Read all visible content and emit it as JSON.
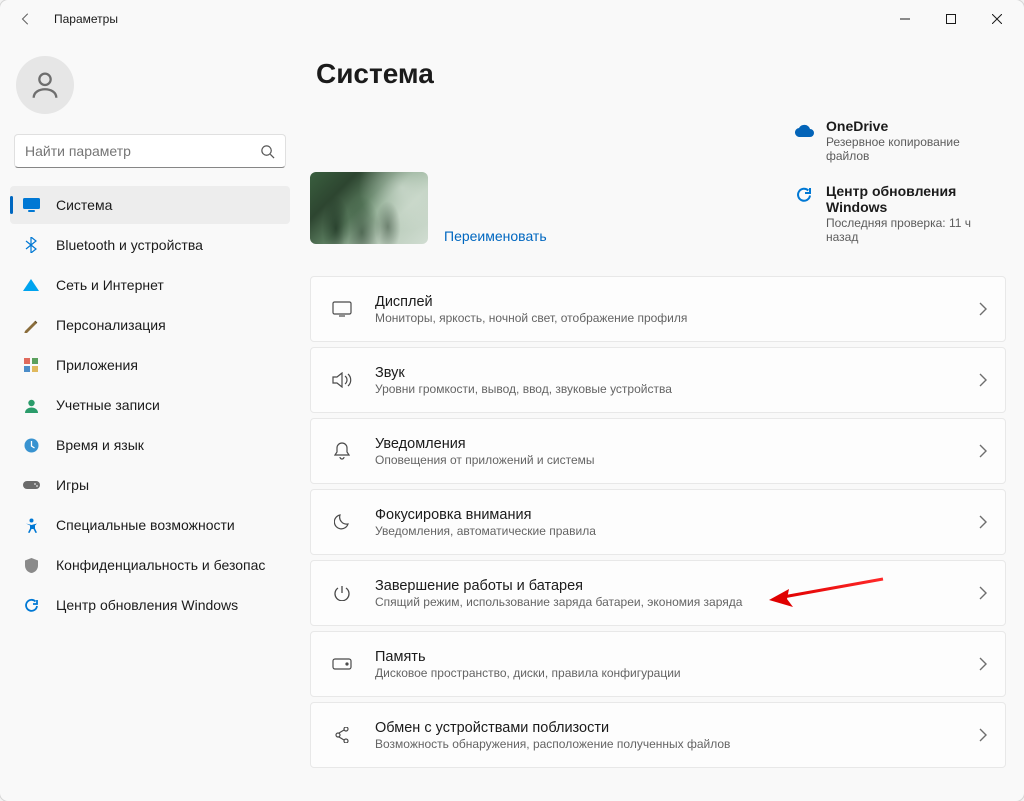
{
  "window": {
    "title": "Параметры"
  },
  "search": {
    "placeholder": "Найти параметр"
  },
  "sidebar": {
    "items": [
      {
        "id": "system",
        "label": "Система"
      },
      {
        "id": "bluetooth",
        "label": "Bluetooth и устройства"
      },
      {
        "id": "network",
        "label": "Сеть и Интернет"
      },
      {
        "id": "personalization",
        "label": "Персонализация"
      },
      {
        "id": "apps",
        "label": "Приложения"
      },
      {
        "id": "accounts",
        "label": "Учетные записи"
      },
      {
        "id": "time",
        "label": "Время и язык"
      },
      {
        "id": "gaming",
        "label": "Игры"
      },
      {
        "id": "accessibility",
        "label": "Специальные возможности"
      },
      {
        "id": "privacy",
        "label": "Конфиденциальность и безопас"
      },
      {
        "id": "update",
        "label": "Центр обновления Windows"
      }
    ]
  },
  "page": {
    "title": "Система",
    "rename": "Переименовать"
  },
  "onedrive": {
    "title": "OneDrive",
    "sub": "Резервное копирование файлов"
  },
  "update": {
    "title": "Центр обновления Windows",
    "sub": "Последняя проверка: 11 ч назад"
  },
  "rows": [
    {
      "title": "Дисплей",
      "sub": "Мониторы, яркость, ночной свет, отображение профиля"
    },
    {
      "title": "Звук",
      "sub": "Уровни громкости, вывод, ввод, звуковые устройства"
    },
    {
      "title": "Уведомления",
      "sub": "Оповещения от приложений и системы"
    },
    {
      "title": "Фокусировка внимания",
      "sub": "Уведомления, автоматические правила"
    },
    {
      "title": "Завершение работы и батарея",
      "sub": "Спящий режим, использование заряда батареи, экономия заряда"
    },
    {
      "title": "Память",
      "sub": "Дисковое пространство, диски, правила конфигурации"
    },
    {
      "title": "Обмен с устройствами поблизости",
      "sub": "Возможность обнаружения, расположение полученных файлов"
    }
  ]
}
